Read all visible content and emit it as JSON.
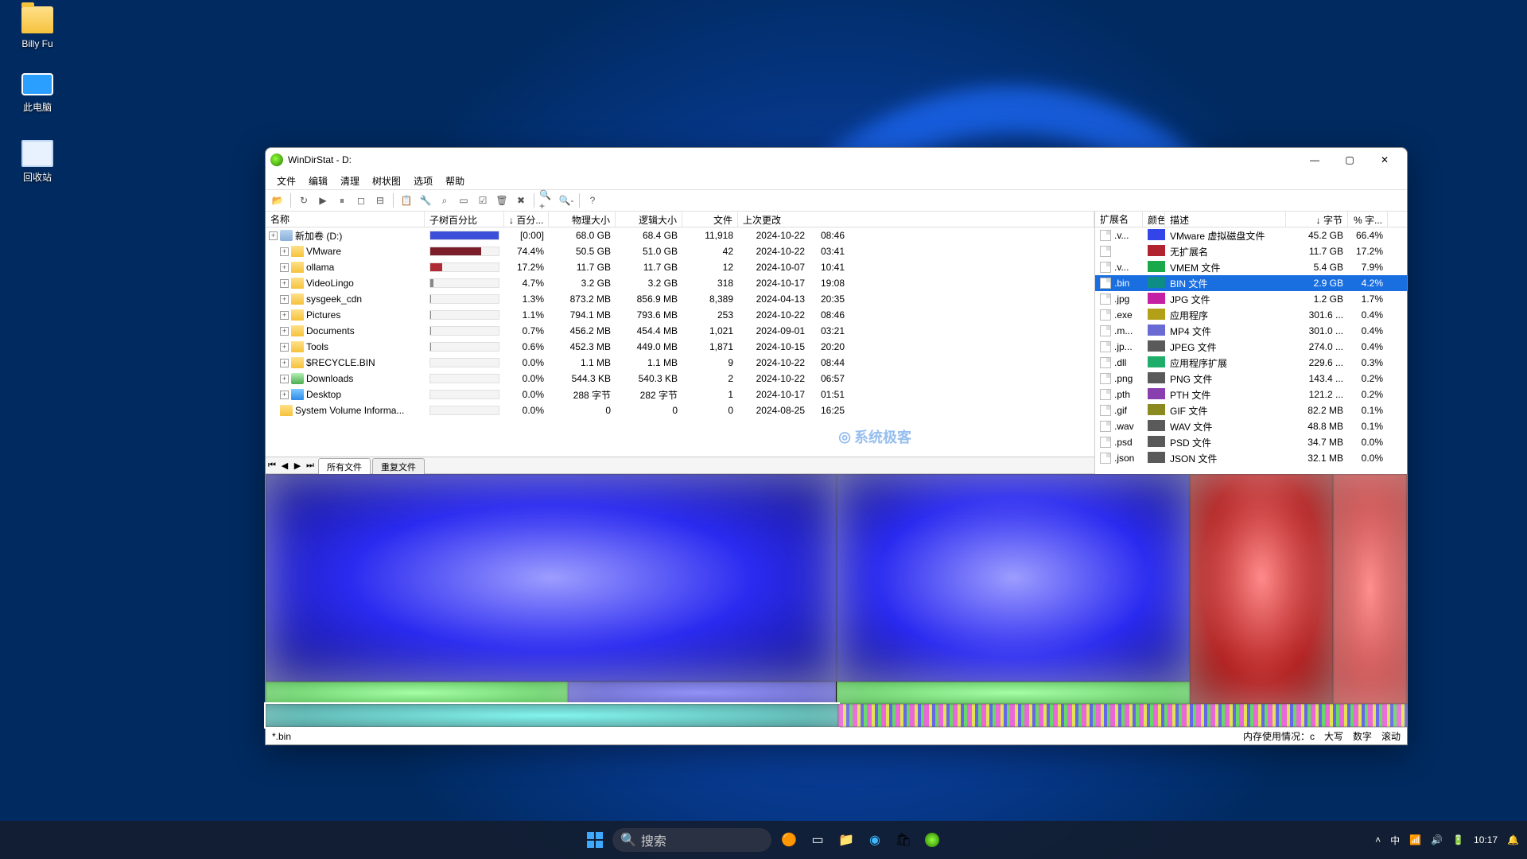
{
  "desktop": {
    "icons": [
      {
        "label": "Billy Fu",
        "type": "folder"
      },
      {
        "label": "此电脑",
        "type": "pc"
      },
      {
        "label": "回收站",
        "type": "bin"
      }
    ]
  },
  "window": {
    "title": "WinDirStat - D:",
    "menu": [
      "文件",
      "编辑",
      "清理",
      "树状图",
      "选项",
      "帮助"
    ]
  },
  "tree": {
    "headers": [
      "名称",
      "子树百分比",
      "↓ 百分...",
      "物理大小",
      "逻辑大小",
      "文件",
      "上次更改"
    ],
    "rows": [
      {
        "name": "新加卷 (D:)",
        "icon": "drive",
        "pct_label": "[0:00]",
        "pct": 100,
        "phys": "68.0 GB",
        "log": "68.4 GB",
        "files": "11,918",
        "date": "2024-10-22",
        "time": "08:46",
        "bar": "#3b4fd8"
      },
      {
        "name": "VMware",
        "icon": "folder",
        "pct_label": "74.4%",
        "pct": 74.4,
        "phys": "50.5 GB",
        "log": "51.0 GB",
        "files": "42",
        "date": "2024-10-22",
        "time": "03:41",
        "bar": "#7a1f2a"
      },
      {
        "name": "ollama",
        "icon": "folder",
        "pct_label": "17.2%",
        "pct": 17.2,
        "phys": "11.7 GB",
        "log": "11.7 GB",
        "files": "12",
        "date": "2024-10-07",
        "time": "10:41",
        "bar": "#b02a36"
      },
      {
        "name": "VideoLingo",
        "icon": "folder",
        "pct_label": "4.7%",
        "pct": 4.7,
        "phys": "3.2 GB",
        "log": "3.2 GB",
        "files": "318",
        "date": "2024-10-17",
        "time": "19:08",
        "bar": "#888"
      },
      {
        "name": "sysgeek_cdn",
        "icon": "folder",
        "pct_label": "1.3%",
        "pct": 1.3,
        "phys": "873.2 MB",
        "log": "856.9 MB",
        "files": "8,389",
        "date": "2024-04-13",
        "time": "20:35",
        "bar": "#888"
      },
      {
        "name": "Pictures",
        "icon": "folder",
        "pct_label": "1.1%",
        "pct": 1.1,
        "phys": "794.1 MB",
        "log": "793.6 MB",
        "files": "253",
        "date": "2024-10-22",
        "time": "08:46",
        "bar": "#888"
      },
      {
        "name": "Documents",
        "icon": "folder",
        "pct_label": "0.7%",
        "pct": 0.7,
        "phys": "456.2 MB",
        "log": "454.4 MB",
        "files": "1,021",
        "date": "2024-09-01",
        "time": "03:21",
        "bar": "#888"
      },
      {
        "name": "Tools",
        "icon": "folder",
        "pct_label": "0.6%",
        "pct": 0.6,
        "phys": "452.3 MB",
        "log": "449.0 MB",
        "files": "1,871",
        "date": "2024-10-15",
        "time": "20:20",
        "bar": "#888"
      },
      {
        "name": "$RECYCLE.BIN",
        "icon": "folder",
        "pct_label": "0.0%",
        "pct": 0,
        "phys": "1.1 MB",
        "log": "1.1 MB",
        "files": "9",
        "date": "2024-10-22",
        "time": "08:44",
        "bar": "#888"
      },
      {
        "name": "Downloads",
        "icon": "dl",
        "pct_label": "0.0%",
        "pct": 0,
        "phys": "544.3 KB",
        "log": "540.3 KB",
        "files": "2",
        "date": "2024-10-22",
        "time": "06:57",
        "bar": "#888"
      },
      {
        "name": "Desktop",
        "icon": "folder-blue",
        "pct_label": "0.0%",
        "pct": 0,
        "phys": "288 字节",
        "log": "282 字节",
        "files": "1",
        "date": "2024-10-17",
        "time": "01:51",
        "bar": "#888"
      },
      {
        "name": "System Volume Informa...",
        "icon": "folder",
        "pct_label": "0.0%",
        "pct": 0,
        "phys": "0",
        "log": "0",
        "files": "0",
        "date": "2024-08-25",
        "time": "16:25",
        "bar": "#888",
        "noexp": true
      }
    ]
  },
  "ext": {
    "headers": [
      "扩展名",
      "颜色",
      "描述",
      "↓ 字节",
      "% 字..."
    ],
    "rows": [
      {
        "ext": ".v...",
        "color": "#3344e8",
        "desc": "VMware 虚拟磁盘文件",
        "bytes": "45.2 GB",
        "pct": "66.4%"
      },
      {
        "ext": "",
        "color": "#b1232f",
        "desc": "无扩展名",
        "bytes": "11.7 GB",
        "pct": "17.2%"
      },
      {
        "ext": ".v...",
        "color": "#19a84a",
        "desc": "VMEM 文件",
        "bytes": "5.4 GB",
        "pct": "7.9%"
      },
      {
        "ext": ".bin",
        "color": "#0e8c86",
        "desc": "BIN 文件",
        "bytes": "2.9 GB",
        "pct": "4.2%",
        "selected": true
      },
      {
        "ext": ".jpg",
        "color": "#c51fa4",
        "desc": "JPG 文件",
        "bytes": "1.2 GB",
        "pct": "1.7%"
      },
      {
        "ext": ".exe",
        "color": "#b2a017",
        "desc": "应用程序",
        "bytes": "301.6 ...",
        "pct": "0.4%"
      },
      {
        "ext": ".m...",
        "color": "#6a6ad4",
        "desc": "MP4 文件",
        "bytes": "301.0 ...",
        "pct": "0.4%"
      },
      {
        "ext": ".jp...",
        "color": "#5a5a5a",
        "desc": "JPEG 文件",
        "bytes": "274.0 ...",
        "pct": "0.4%"
      },
      {
        "ext": ".dll",
        "color": "#1fae69",
        "desc": "应用程序扩展",
        "bytes": "229.6 ...",
        "pct": "0.3%"
      },
      {
        "ext": ".png",
        "color": "#5a5a5a",
        "desc": "PNG 文件",
        "bytes": "143.4 ...",
        "pct": "0.2%"
      },
      {
        "ext": ".pth",
        "color": "#8a3fb0",
        "desc": "PTH 文件",
        "bytes": "121.2 ...",
        "pct": "0.2%"
      },
      {
        "ext": ".gif",
        "color": "#8a8a20",
        "desc": "GIF 文件",
        "bytes": "82.2 MB",
        "pct": "0.1%"
      },
      {
        "ext": ".wav",
        "color": "#5a5a5a",
        "desc": "WAV 文件",
        "bytes": "48.8 MB",
        "pct": "0.1%"
      },
      {
        "ext": ".psd",
        "color": "#5a5a5a",
        "desc": "PSD 文件",
        "bytes": "34.7 MB",
        "pct": "0.0%"
      },
      {
        "ext": ".json",
        "color": "#5a5a5a",
        "desc": "JSON 文件",
        "bytes": "32.1 MB",
        "pct": "0.0%"
      }
    ]
  },
  "tabs": {
    "active": "所有文件",
    "inactive": "重复文件"
  },
  "watermark": "系统极客",
  "status": {
    "left": "*.bin",
    "mem": "内存使用情况：c",
    "caps": "大写",
    "num": "数字",
    "scroll": "滚动"
  },
  "taskbar": {
    "search_placeholder": "搜索",
    "ime": "中",
    "time": "10:17"
  }
}
